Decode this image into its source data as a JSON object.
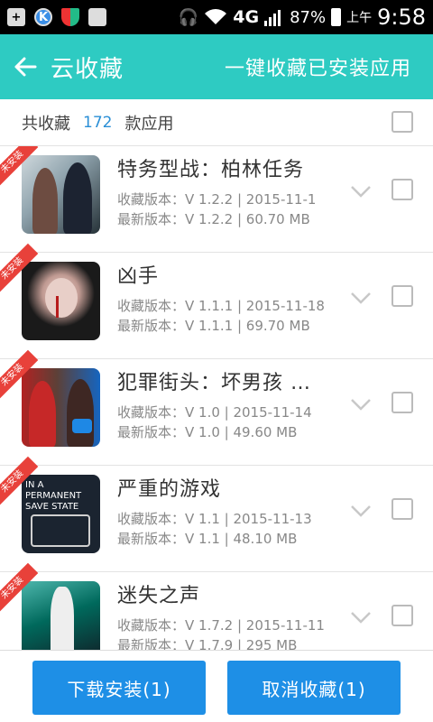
{
  "status_bar": {
    "network": "4G",
    "battery": "87%",
    "ampm": "上午",
    "time": "9:58"
  },
  "header": {
    "title": "云收藏",
    "action": "一键收藏已安装应用"
  },
  "summary": {
    "prefix": "共收藏",
    "count": "172",
    "suffix": "款应用"
  },
  "apps": [
    {
      "badge": "未安装",
      "name": "特务型战：柏林任务",
      "collected_line": "收藏版本：V 1.2.2 | 2015-11-1",
      "latest_line": "最新版本：V 1.2.2 | 60.70 MB"
    },
    {
      "badge": "未安装",
      "name": "凶手",
      "collected_line": "收藏版本：V 1.1.1 | 2015-11-18",
      "latest_line": "最新版本：V 1.1.1 | 69.70 MB"
    },
    {
      "badge": "未安装",
      "name": "犯罪街头：坏男孩 …",
      "collected_line": "收藏版本：V 1.0 | 2015-11-14",
      "latest_line": "最新版本：V 1.0 | 49.60 MB"
    },
    {
      "badge": "未安装",
      "name": "严重的游戏",
      "collected_line": "收藏版本：V 1.1 | 2015-11-13",
      "latest_line": "最新版本：V 1.1 | 48.10 MB",
      "thumb_text": "IN A PERMANENT SAVE STATE"
    },
    {
      "badge": "未安装",
      "name": "迷失之声",
      "collected_line": "收藏版本：V 1.7.2 | 2015-11-11",
      "latest_line": "最新版本：V 1.7.9 | 295 MB"
    }
  ],
  "bottom": {
    "install_label": "下载安装(1)",
    "cancel_label": "取消收藏(1)"
  },
  "colors": {
    "header": "#2ecbc2",
    "button": "#1e8fe6",
    "badge": "#e8413a",
    "count": "#2a8fd6"
  }
}
